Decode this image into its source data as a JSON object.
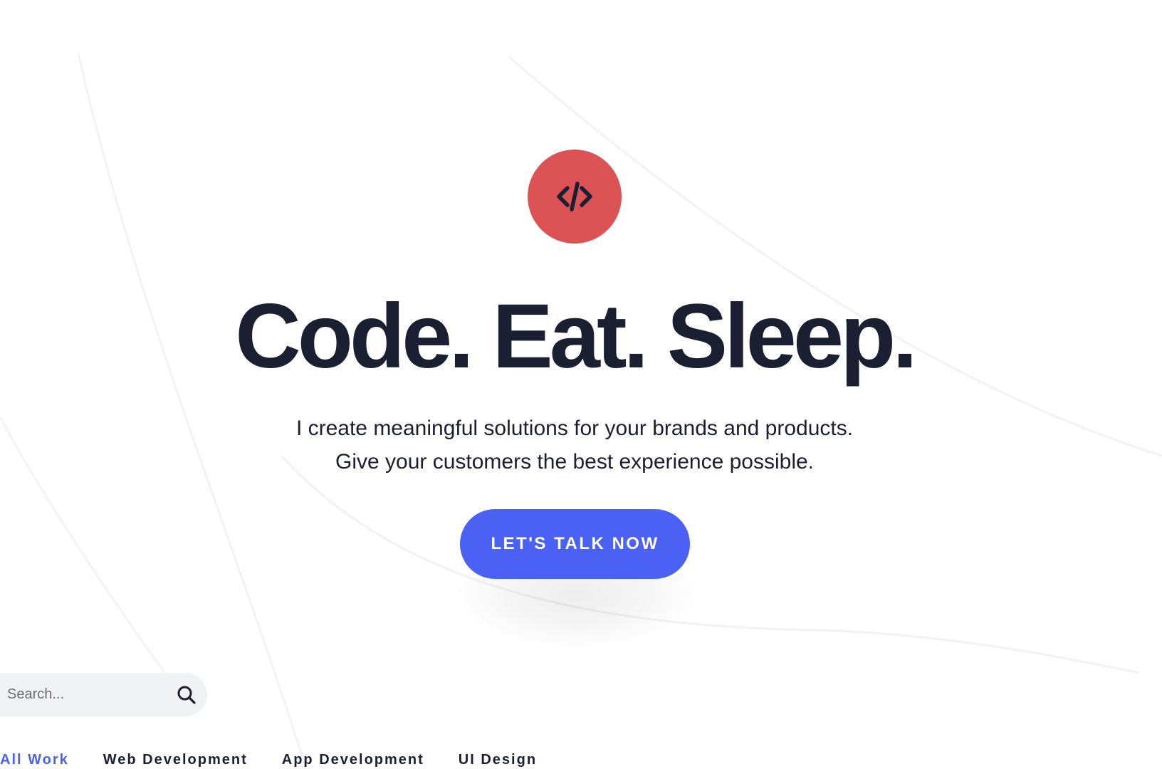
{
  "colors": {
    "accent": "#4a61f4",
    "badge": "#dc5355",
    "text": "#1b1f32",
    "search_bg": "#f1f2f4"
  },
  "hero": {
    "logo_icon": "code-brackets-icon",
    "headline": "Code. Eat. Sleep.",
    "subtext_line1": "I create meaningful solutions for your brands and products.",
    "subtext_line2": "Give your customers the best experience possible.",
    "cta_label": "LET'S TALK NOW"
  },
  "search": {
    "placeholder": "Search...",
    "icon": "search-icon"
  },
  "filters": {
    "active": "All Work",
    "items": [
      {
        "label": "All Work"
      },
      {
        "label": "Web Development"
      },
      {
        "label": "App Development"
      },
      {
        "label": "UI Design"
      }
    ]
  }
}
